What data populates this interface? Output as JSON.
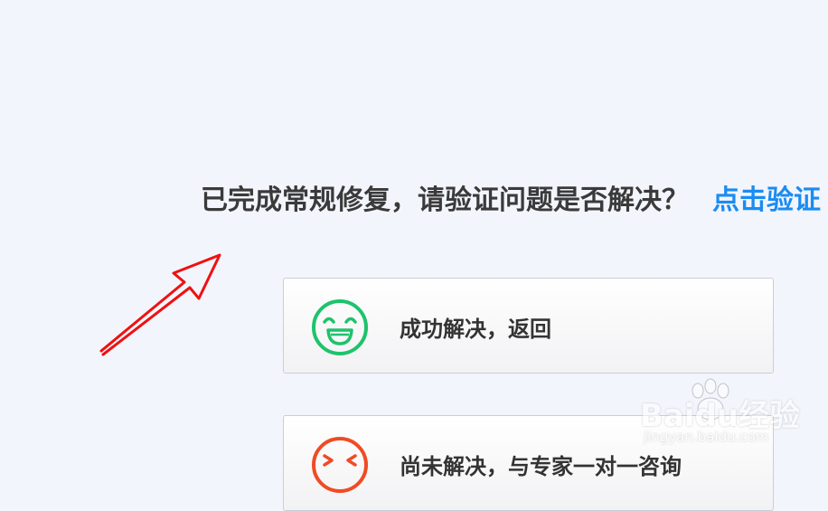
{
  "headline": {
    "text": "已完成常规修复，请验证问题是否解决？",
    "link": "点击验证"
  },
  "options": {
    "resolved": {
      "label": "成功解决，返回",
      "icon": "smiling-face-icon",
      "color": "#1ec36b"
    },
    "unresolved": {
      "label": "尚未解决，与专家一对一咨询",
      "icon": "frowning-face-icon",
      "color": "#f04b23"
    }
  },
  "annotation": {
    "icon": "red-arrow-icon",
    "color": "#ee1111"
  },
  "watermark": {
    "brand": "Baidu经验",
    "url": "jingyan.baidu.com"
  }
}
